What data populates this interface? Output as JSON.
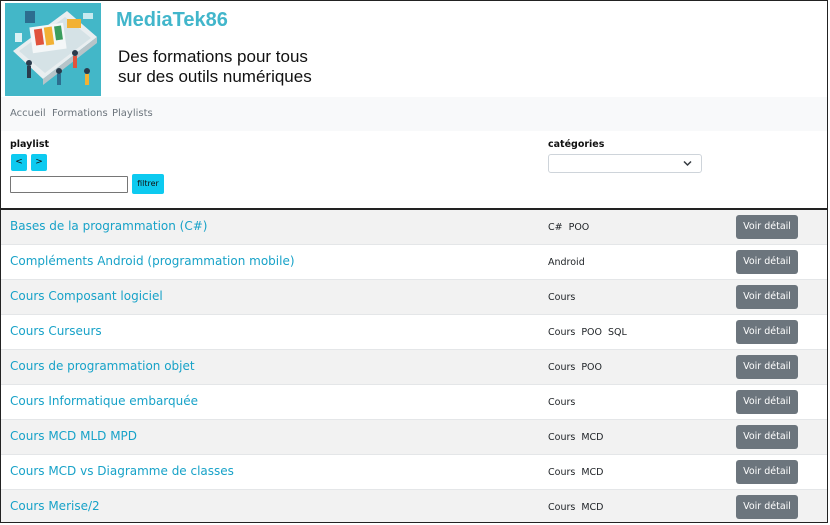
{
  "header": {
    "site_title": "MediaTek86",
    "tagline_line1": "Des formations pour tous",
    "tagline_line2": "sur des outils numériques"
  },
  "nav": [
    {
      "label": "Accueil"
    },
    {
      "label": "Formations"
    },
    {
      "label": "Playlists"
    }
  ],
  "filters": {
    "playlist_label": "playlist",
    "sort_asc_label": "<",
    "sort_desc_label": ">",
    "search_value": "",
    "filter_button": "filtrer",
    "categories_label": "catégories",
    "categories_selected": ""
  },
  "rows": [
    {
      "title": "Bases de la programmation (C#)",
      "categories": [
        "C#",
        "POO"
      ],
      "button": "Voir détail"
    },
    {
      "title": "Compléments Android (programmation mobile)",
      "categories": [
        "Android"
      ],
      "button": "Voir détail"
    },
    {
      "title": "Cours Composant logiciel",
      "categories": [
        "Cours"
      ],
      "button": "Voir détail"
    },
    {
      "title": "Cours Curseurs",
      "categories": [
        "Cours",
        "POO",
        "SQL"
      ],
      "button": "Voir détail"
    },
    {
      "title": "Cours de programmation objet",
      "categories": [
        "Cours",
        "POO"
      ],
      "button": "Voir détail"
    },
    {
      "title": "Cours Informatique embarquée",
      "categories": [
        "Cours"
      ],
      "button": "Voir détail"
    },
    {
      "title": "Cours MCD MLD MPD",
      "categories": [
        "Cours",
        "MCD"
      ],
      "button": "Voir détail"
    },
    {
      "title": "Cours MCD vs Diagramme de classes",
      "categories": [
        "Cours",
        "MCD"
      ],
      "button": "Voir détail"
    },
    {
      "title": "Cours Merise/2",
      "categories": [
        "Cours",
        "MCD"
      ],
      "button": "Voir détail"
    }
  ],
  "colors": {
    "brand_teal": "#42b6cb",
    "link": "#17a2c8",
    "info_button": "#0dcaf0",
    "secondary_button": "#6c757d"
  }
}
